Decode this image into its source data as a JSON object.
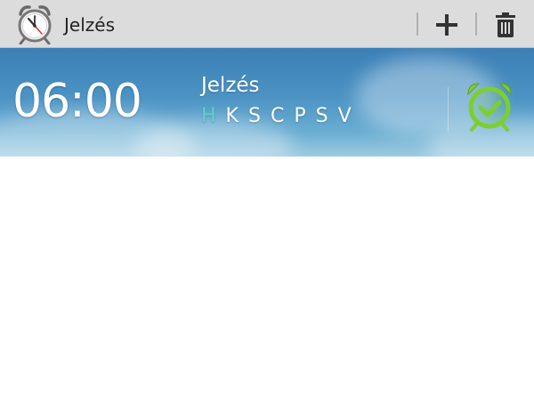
{
  "action_bar": {
    "title": "Jelzés",
    "app_icon": "alarm-clock-icon",
    "add_icon": "plus-icon",
    "delete_icon": "trash-icon"
  },
  "alarm": {
    "time": "06:00",
    "label": "Jelzés",
    "days": [
      {
        "letter": "H",
        "active": true
      },
      {
        "letter": "K",
        "active": false
      },
      {
        "letter": "S",
        "active": false
      },
      {
        "letter": "C",
        "active": false
      },
      {
        "letter": "P",
        "active": false
      },
      {
        "letter": "S",
        "active": false
      },
      {
        "letter": "V",
        "active": false
      }
    ],
    "enabled": true,
    "toggle_icon": "alarm-check-icon"
  },
  "colors": {
    "action_bar_bg": "#dcdcdc",
    "active_day": "#5fd2cf",
    "alarm_enabled": "#7ccf2e"
  }
}
